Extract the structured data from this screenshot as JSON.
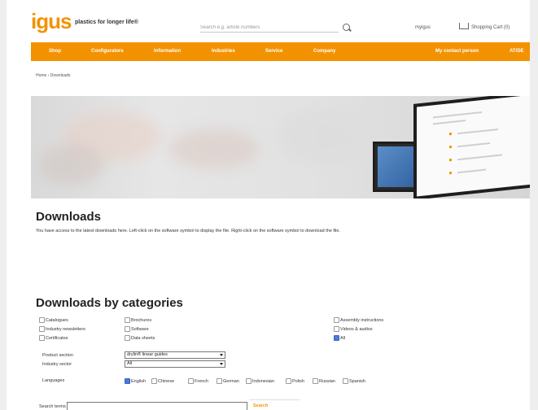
{
  "header": {
    "logo": "igus",
    "tagline": "plastics for longer life®",
    "search_placeholder": "Search e.g. article numbers",
    "myigus": "myigus",
    "cart": "Shopping Cart (0)"
  },
  "nav": {
    "items": [
      "Shop",
      "Configurators",
      "Information",
      "Industries",
      "Service",
      "Company"
    ],
    "contact": "My contact person",
    "region": "AT/DE"
  },
  "breadcrumb": "Home  ›  Downloads",
  "downloads": {
    "heading": "Downloads",
    "intro": "You have access to the latest downloads here. Left-click on the software symbol to display the file. Right-click on the software symbol to download the file."
  },
  "categories": {
    "heading": "Downloads by categories",
    "col1": [
      "Catalogues",
      "Industry newsletters",
      "Certificates"
    ],
    "col2": [
      "Brochures",
      "Software",
      "Data sheets"
    ],
    "col3": [
      "Assembly instructions",
      "Videos & audios",
      "All"
    ],
    "col3_checked": [
      false,
      false,
      true
    ],
    "product_section_label": "Product section",
    "product_section_value": "drylin® linear guides",
    "industry_sector_label": "Industry sector",
    "industry_sector_value": "All",
    "languages_label": "Languages",
    "languages": [
      "English",
      "Chinese",
      "French",
      "German",
      "Indonesian",
      "Polish",
      "Russian",
      "Spanish"
    ],
    "languages_checked": [
      true,
      false,
      false,
      false,
      false,
      false,
      false,
      false
    ],
    "search_terms_label": "Search terms",
    "search_button": "Search"
  },
  "colors": {
    "brand_orange": "#f39200",
    "checkbox_checked": "#4a7bd8"
  }
}
